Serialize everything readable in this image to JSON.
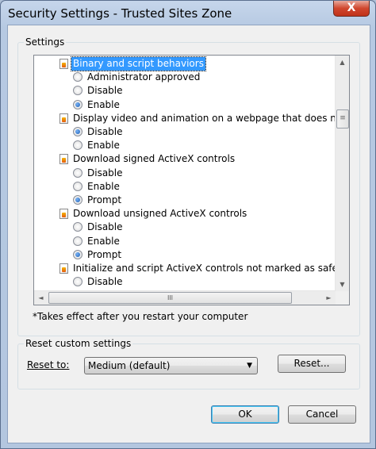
{
  "window": {
    "title": "Security Settings - Trusted Sites Zone",
    "close_glyph": "X"
  },
  "settings_group": {
    "label": "Settings",
    "items": [
      {
        "kind": "header",
        "label": "Binary and script behaviors",
        "selected": true
      },
      {
        "kind": "option",
        "label": "Administrator approved",
        "checked": false
      },
      {
        "kind": "option",
        "label": "Disable",
        "checked": false
      },
      {
        "kind": "option",
        "label": "Enable",
        "checked": true
      },
      {
        "kind": "header",
        "label": "Display video and animation on a webpage that does not use"
      },
      {
        "kind": "option",
        "label": "Disable",
        "checked": true
      },
      {
        "kind": "option",
        "label": "Enable",
        "checked": false
      },
      {
        "kind": "header",
        "label": "Download signed ActiveX controls"
      },
      {
        "kind": "option",
        "label": "Disable",
        "checked": false
      },
      {
        "kind": "option",
        "label": "Enable",
        "checked": false
      },
      {
        "kind": "option",
        "label": "Prompt",
        "checked": true
      },
      {
        "kind": "header",
        "label": "Download unsigned ActiveX controls"
      },
      {
        "kind": "option",
        "label": "Disable",
        "checked": false
      },
      {
        "kind": "option",
        "label": "Enable",
        "checked": false
      },
      {
        "kind": "option",
        "label": "Prompt",
        "checked": true
      },
      {
        "kind": "header",
        "label": "Initialize and script ActiveX controls not marked as safe for s"
      },
      {
        "kind": "option",
        "label": "Disable",
        "checked": false
      }
    ],
    "scroll": {
      "up": "▲",
      "down": "▼",
      "left": "◄",
      "right": "►",
      "grip": "III",
      "vgrip": "≡"
    },
    "note": "*Takes effect after you restart your computer"
  },
  "reset_group": {
    "label": "Reset custom settings",
    "reset_to_label": "Reset to:",
    "reset_to_value": "Medium (default)",
    "combo_arrow": "▼",
    "reset_button": "Reset..."
  },
  "footer": {
    "ok_label": "OK",
    "cancel_label": "Cancel"
  }
}
